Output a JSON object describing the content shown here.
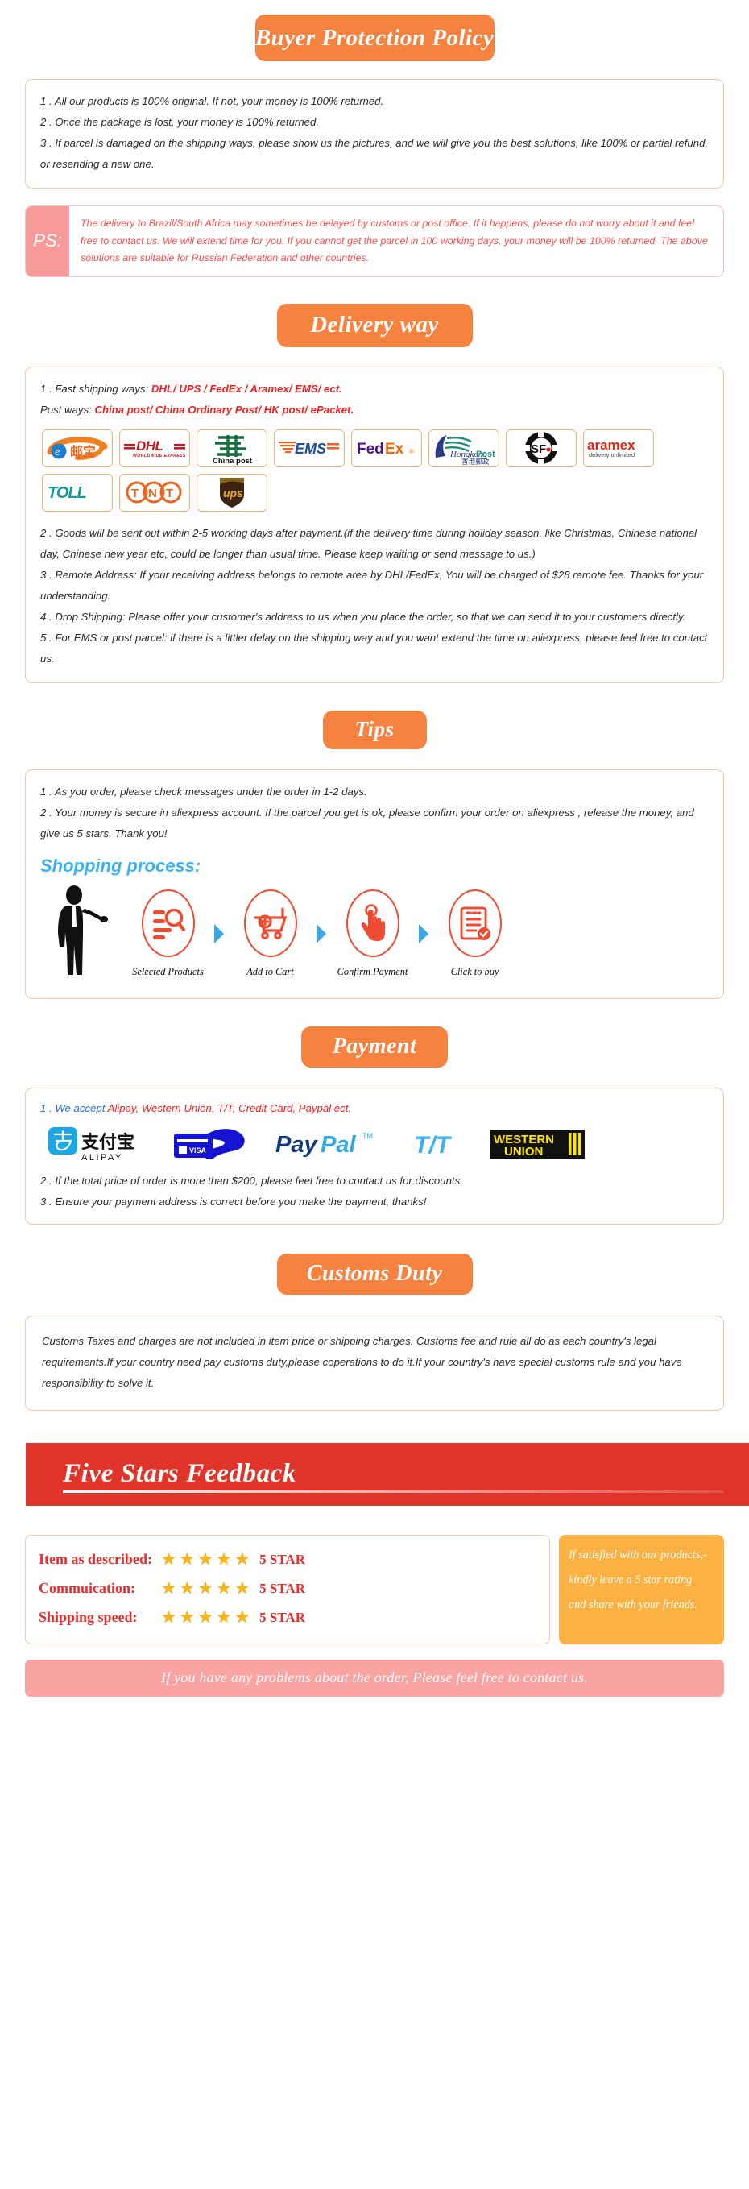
{
  "buyer_protection": {
    "banner": "Buyer Protection Policy",
    "items": [
      "1 . All our products is 100% original. If not, your money is 100% returned.",
      "2 . Once the package is lost, your money is 100% returned.",
      "3 . If parcel is damaged on the shipping ways, please show us the pictures, and we will give you the best solutions, like 100% or partial refund, or resending a new one."
    ],
    "ps_label": "PS:",
    "ps_text": "The delivery to Brazil/South Africa may sometimes be delayed by customs or post office. If it happens, please do not worry about it and feel free to contact us. We will extend time for you. If you cannot get the parcel in 100 working days, your money will be 100% returned. The above solutions are suitable for Russian Federation and other countries."
  },
  "delivery": {
    "banner": "Delivery way",
    "fast_label": "1 . Fast shipping ways:",
    "fast_value": "DHL/ UPS / FedEx / Aramex/ EMS/ ect.",
    "post_label": "Post ways:",
    "post_value": "China post/ China Ordinary Post/ HK post/ ePacket.",
    "carriers": [
      {
        "name": "epost-bao-logo",
        "label": "e邮宝"
      },
      {
        "name": "dhl-logo",
        "label": "DHL"
      },
      {
        "name": "china-post-logo",
        "label": "China post"
      },
      {
        "name": "ems-logo",
        "label": "EMS"
      },
      {
        "name": "fedex-logo",
        "label": "FedEx"
      },
      {
        "name": "hongkong-post-logo",
        "label": "Hongkong Post 香港郵政"
      },
      {
        "name": "sf-express-logo",
        "label": "SF"
      },
      {
        "name": "aramex-logo",
        "label": "aramex delivery unlimited"
      },
      {
        "name": "toll-logo",
        "label": "TOLL"
      },
      {
        "name": "tnt-logo",
        "label": "TNT"
      },
      {
        "name": "ups-logo",
        "label": "ups"
      }
    ],
    "items": [
      "2 . Goods will be sent out within 2-5 working days after payment.(if the delivery time during holiday season, like Christmas, Chinese national day, Chinese new year etc, could be longer than usual time. Please keep waiting or send message to us.)",
      "3 . Remote Address: If your receiving address belongs to remote area by DHL/FedEx, You will be charged of $28 remote fee. Thanks for your understanding.",
      "4 . Drop Shipping: Please offer your customer's address to us when you place the order, so that we can send it to your customers directly.",
      "5 . For EMS or post parcel: if there is a littler delay on the shipping way and you want extend the time on aliexpress, please feel free to contact us."
    ]
  },
  "tips": {
    "banner": "Tips",
    "items": [
      "1 .  As you order, please check messages under the order in 1-2 days.",
      "2 . Your money is secure in aliexpress account. If the parcel you get is ok, please confirm your order on aliexpress , release the money, and give us 5 stars. Thank you!"
    ],
    "process_title": "Shopping process:",
    "steps": [
      {
        "icon": "search-list-icon",
        "label": "Selected Products"
      },
      {
        "icon": "shopping-cart-add-icon",
        "label": "Add to Cart"
      },
      {
        "icon": "hand-click-icon",
        "label": "Confirm Payment"
      },
      {
        "icon": "checklist-approved-icon",
        "label": "Click to buy"
      }
    ]
  },
  "payment": {
    "banner": "Payment",
    "accept_label": "1 . We accept",
    "accept_value": "Alipay, Western Union, T/T, Credit Card, Paypal ect.",
    "methods": [
      {
        "name": "alipay-logo",
        "label": "ALIPAY"
      },
      {
        "name": "visa-credit-card-logo",
        "label": "VISA"
      },
      {
        "name": "paypal-logo",
        "label": "PayPal"
      },
      {
        "name": "tt-transfer-logo",
        "label": "T/T"
      },
      {
        "name": "western-union-logo",
        "label": "WESTERN UNION"
      }
    ],
    "items": [
      "2 . If the total price of order is more than $200, please feel free to contact us for discounts.",
      "3 . Ensure your payment address is correct before you make the payment, thanks!"
    ]
  },
  "customs": {
    "banner": "Customs Duty",
    "text": "Customs Taxes and charges are not included in item price or shipping charges. Customs fee and rule all do as each country's legal requirements.If your country need pay customs duty,please coperations to do it.If your country's have special customs rule and you have responsibility to solve it."
  },
  "feedback": {
    "header": "Five Stars Feedback",
    "rows": [
      {
        "name": "Item as described:",
        "stars": 5,
        "value": "5 STAR"
      },
      {
        "name": "Commuication:",
        "stars": 5,
        "value": "5 STAR"
      },
      {
        "name": "Shipping speed:",
        "stars": 5,
        "value": "5 STAR"
      }
    ],
    "note_lines": [
      "If satisfied with our products,-",
      "kindly leave a 5 star rating",
      "and share with your friends."
    ],
    "footer": "If you have any problems about the order, Please feel free to contact us."
  },
  "colors": {
    "orange": "#f5823f",
    "red": "#e0342a",
    "pink": "#f99a9a",
    "amber": "#fcb143",
    "card_border": "#f5c7a8"
  }
}
